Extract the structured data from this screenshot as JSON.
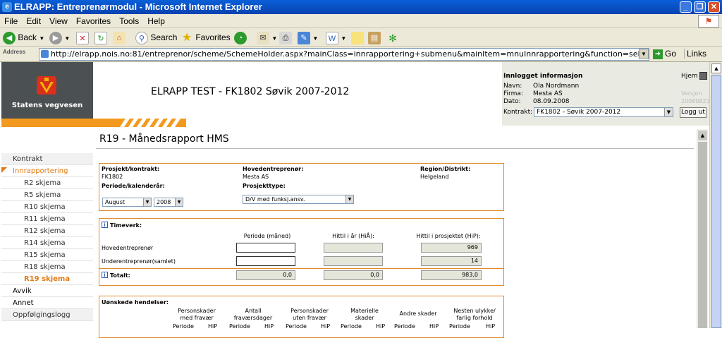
{
  "window": {
    "title": "ELRAPP: Entreprenørmodul - Microsoft Internet Explorer"
  },
  "menu": [
    "File",
    "Edit",
    "View",
    "Favorites",
    "Tools",
    "Help"
  ],
  "toolbar": {
    "back": "Back",
    "search": "Search",
    "favorites": "Favorites"
  },
  "address": {
    "label": "Address",
    "url": "http://elrapp.nois.no:81/entreprenor/scheme/SchemeHolder.aspx?mainClass=innrapportering+submenu&mainItem=mnuInnrapportering&function=selectSub&objClass=innrappo",
    "go": "Go",
    "links": "Links"
  },
  "header": {
    "logo_text": "Statens vegvesen",
    "title": "ELRAPP TEST - FK1802 Søvik 2007-2012"
  },
  "login": {
    "heading": "Innlogget informasjon",
    "home": "Hjem",
    "name_label": "Navn:",
    "name": "Ola Nordmann",
    "company_label": "Firma:",
    "company": "Mesta AS",
    "date_label": "Dato:",
    "date": "08.09.2008",
    "version_label": "Versjon",
    "version": "20080821",
    "contract_label": "Kontrakt:",
    "contract": "FK1802 - Søvik 2007-2012",
    "logout": "Logg ut"
  },
  "sidebar": {
    "items": [
      {
        "label": "Kontrakt"
      },
      {
        "label": "Innrapportering"
      },
      {
        "label": "R2 skjema"
      },
      {
        "label": "R5 skjema"
      },
      {
        "label": "R10 skjema"
      },
      {
        "label": "R11 skjema"
      },
      {
        "label": "R12 skjema"
      },
      {
        "label": "R14 skjema"
      },
      {
        "label": "R15 skjema"
      },
      {
        "label": "R18 skjema"
      },
      {
        "label": "R19 skjema"
      },
      {
        "label": "Avvik"
      },
      {
        "label": "Annet"
      },
      {
        "label": "Oppfølgingslogg"
      }
    ]
  },
  "main": {
    "title": "R19 - Månedsrapport HMS",
    "project": {
      "project_label": "Prosjekt/kontrakt:",
      "project": "FK1802",
      "contractor_label": "Hovedentreprenør:",
      "contractor": "Mesta AS",
      "region_label": "Region/Distrikt:",
      "region": "Helgeland",
      "period_label": "Periode/kalenderår:",
      "month": "August",
      "year": "2008",
      "type_label": "Prosjekttype:",
      "type": "D/V med funksj.ansv."
    },
    "timeverk": {
      "label": "Timeverk:",
      "col_period": "Periode (måned)",
      "col_year": "Hittil i år (HiÅ):",
      "col_project": "Hittil i prosjektet (HiP):",
      "rows": [
        {
          "label": "Hovedentreprenør",
          "period": "",
          "year": "",
          "project": "969"
        },
        {
          "label": "Underentreprenør(samlet)",
          "period": "",
          "year": "",
          "project": "14"
        }
      ],
      "total_label": "Totalt:",
      "total_period": "0,0",
      "total_year": "0,0",
      "total_project": "983,0"
    },
    "events": {
      "label": "Uønskede hendelser:",
      "columns": [
        {
          "title1": "Personskader",
          "title2": "med fravær"
        },
        {
          "title1": "Antall",
          "title2": "fraværsdager"
        },
        {
          "title1": "Personskader",
          "title2": "uten fravær"
        },
        {
          "title1": "Materielle",
          "title2": "skader"
        },
        {
          "title1": "Andre skader",
          "title2": ""
        },
        {
          "title1": "Nesten ulykke/",
          "title2": "farlig forhold"
        }
      ],
      "sub_period": "Periode",
      "sub_hip": "HiP"
    }
  }
}
